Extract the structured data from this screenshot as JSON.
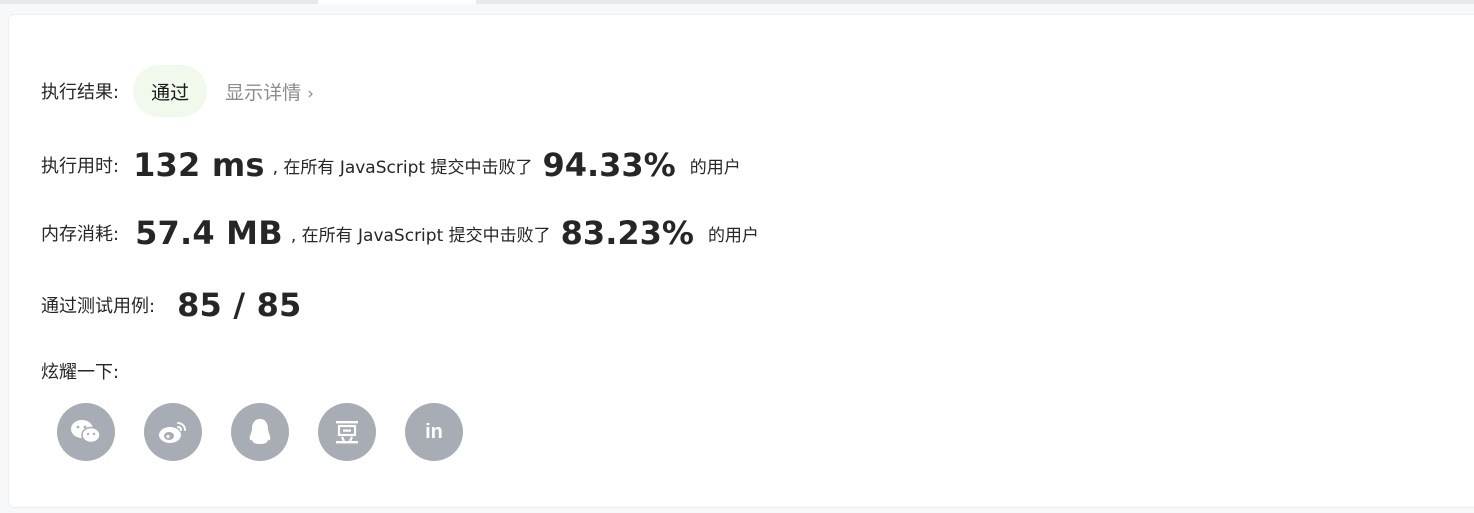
{
  "submission": {
    "result_label": "执行结果:",
    "result_value": "通过",
    "details_link": "显示详情",
    "details_chevron": "›",
    "time_label": "执行用时:",
    "time_value": "132 ms",
    "time_suffix": ", 在所有 JavaScript 提交中击败了",
    "time_percent": "94.33%",
    "time_users": "的用户",
    "memory_label": "内存消耗:",
    "memory_value": "57.4 MB",
    "memory_suffix": ", 在所有 JavaScript 提交中击败了",
    "memory_percent": "83.23%",
    "memory_users": "的用户",
    "tests_label": "通过测试用例:",
    "tests_value": "85 / 85"
  },
  "share": {
    "label": "炫耀一下:",
    "icons": [
      {
        "name": "wechat-icon"
      },
      {
        "name": "weibo-icon"
      },
      {
        "name": "qq-icon"
      },
      {
        "name": "douban-icon"
      },
      {
        "name": "linkedin-icon",
        "text": "in"
      }
    ]
  },
  "colors": {
    "badge_bg": "#f1f8ec",
    "icon_bg": "#a8acb4",
    "link_gray": "#8c8c8c"
  }
}
